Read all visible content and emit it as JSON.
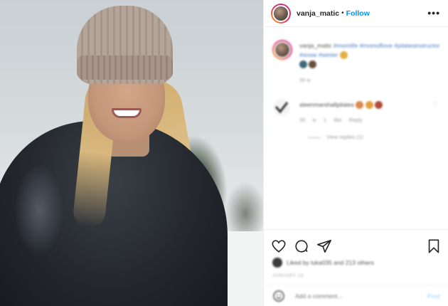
{
  "header": {
    "username": "vanja_matic",
    "separator": "•",
    "follow_label": "Follow",
    "more_label": "•••"
  },
  "caption": {
    "username": "vanja_matic",
    "hashtags": "#momlife #momoflove #pilatesinstructor #snow #winter",
    "time": "35 w"
  },
  "comment": {
    "username": "sleenmarshallpilates",
    "time": "35 w",
    "likes": "1 like",
    "reply_label": "Reply",
    "view_replies": "View replies (1)"
  },
  "likes": {
    "text": "Liked by luka035 and 213 others"
  },
  "date": "JANUARY 13",
  "add_comment": {
    "placeholder": "Add a comment...",
    "post_label": "Post"
  },
  "icons": [
    "heart-icon",
    "comment-icon",
    "share-icon",
    "bookmark-icon",
    "smiley-icon",
    "more-icon"
  ],
  "colors": {
    "link_blue": "#0095f6",
    "post_disabled": "#b3dbff",
    "text": "#262626"
  }
}
